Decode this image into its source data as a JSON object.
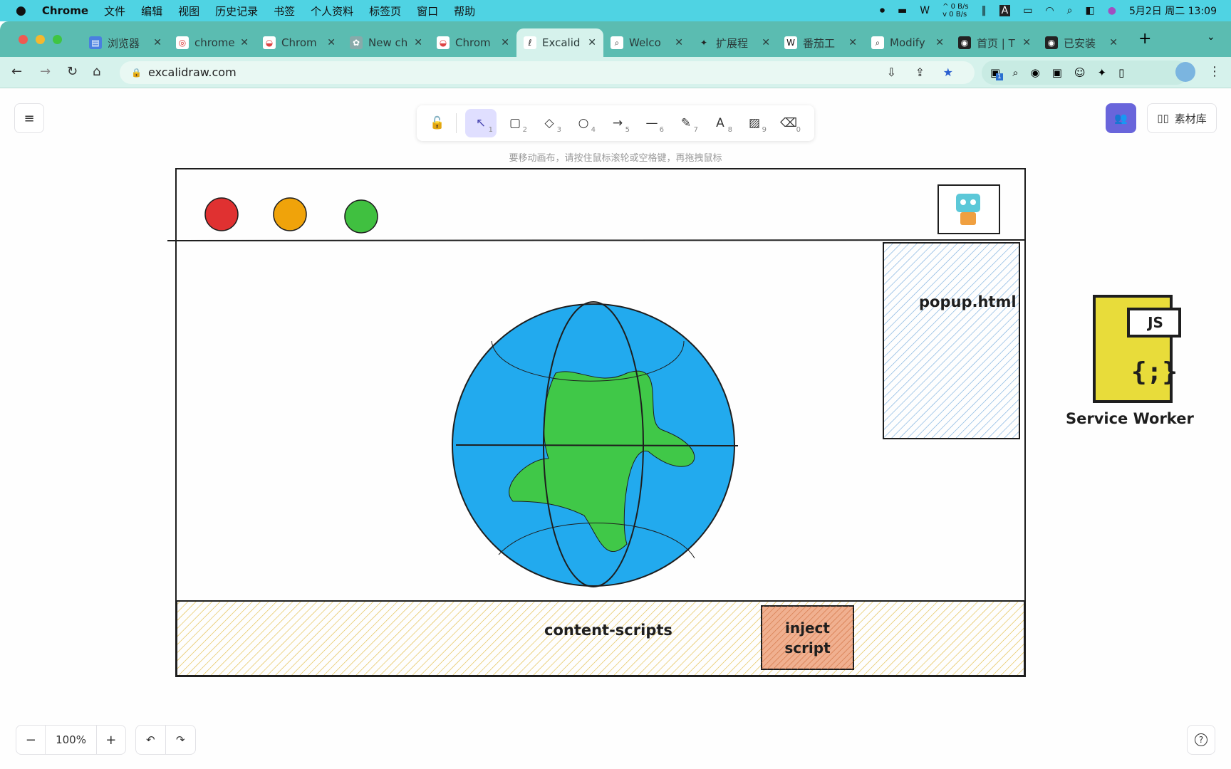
{
  "menubar": {
    "app": "Chrome",
    "items": [
      "文件",
      "编辑",
      "视图",
      "历史记录",
      "书签",
      "个人资料",
      "标签页",
      "窗口",
      "帮助"
    ],
    "net_up": "0 B/s",
    "net_down": "0 B/s",
    "datetime": "5月2日 周二 13:09"
  },
  "tabs": [
    {
      "label": "浏览器",
      "icon": "docs-icon"
    },
    {
      "label": "chrome",
      "icon": "chrome-icon"
    },
    {
      "label": "Chrom",
      "icon": "chrome-store-icon"
    },
    {
      "label": "New ch",
      "icon": "openai-icon"
    },
    {
      "label": "Chrom",
      "icon": "chrome-store-icon"
    },
    {
      "label": "Excalid",
      "icon": "excalidraw-icon",
      "active": true
    },
    {
      "label": "Welco",
      "icon": "search-icon"
    },
    {
      "label": "扩展程",
      "icon": "puzzle-icon"
    },
    {
      "label": "番茄工",
      "icon": "wikipedia-icon"
    },
    {
      "label": "Modify",
      "icon": "search-icon"
    },
    {
      "label": "首页 | T",
      "icon": "app-icon"
    },
    {
      "label": "已安装",
      "icon": "app-icon"
    }
  ],
  "address": {
    "url": "excalidraw.com",
    "ext_badge": "1"
  },
  "toolbar": {
    "tools": [
      {
        "name": "selection",
        "key": "1",
        "icon": "↖"
      },
      {
        "name": "rectangle",
        "key": "2",
        "icon": "▢"
      },
      {
        "name": "diamond",
        "key": "3",
        "icon": "◇"
      },
      {
        "name": "ellipse",
        "key": "4",
        "icon": "○"
      },
      {
        "name": "arrow",
        "key": "5",
        "icon": "→"
      },
      {
        "name": "line",
        "key": "6",
        "icon": "—"
      },
      {
        "name": "draw",
        "key": "7",
        "icon": "✎"
      },
      {
        "name": "text",
        "key": "8",
        "icon": "A"
      },
      {
        "name": "image",
        "key": "9",
        "icon": "▨"
      },
      {
        "name": "eraser",
        "key": "0",
        "icon": "⌫"
      }
    ],
    "hint": "要移动画布，请按住鼠标滚轮或空格键，再拖拽鼠标"
  },
  "library_label": "素材库",
  "drawing": {
    "popup": "popup.html",
    "content_scripts": "content-scripts",
    "inject": [
      "inject",
      "script"
    ],
    "js_badge": "JS",
    "service_worker": "Service Worker",
    "colors": {
      "red": "#e03131",
      "orange": "#f0a30a",
      "green": "#40c040",
      "globe": "#22aaee",
      "land": "#40c848",
      "popup_hatch": "#7fb3e0",
      "content_hatch": "#e8c040",
      "inject_fill": "#e8956a",
      "js_file": "#e8dc3a"
    }
  },
  "footer": {
    "zoom": "100%",
    "zoom_out": "−",
    "zoom_in": "+",
    "undo": "↶",
    "redo": "↷",
    "help": "?"
  }
}
